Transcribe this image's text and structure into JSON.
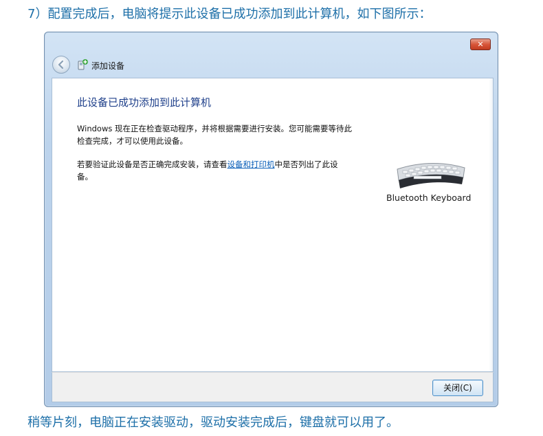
{
  "caption_top": "7）配置完成后，电脑将提示此设备已成功添加到此计算机，如下图所示：",
  "caption_bottom": "稍等片刻，电脑正在安装驱动，驱动安装完成后，键盘就可以用了。",
  "window": {
    "close_glyph": "✕",
    "title": "添加设备",
    "back_icon": "back-arrow-icon",
    "title_icon": "add-device-icon"
  },
  "content": {
    "heading": "此设备已成功添加到此计算机",
    "para1": "Windows 现在正在检查驱动程序，并将根据需要进行安装。您可能需要等待此检查完成，才可以使用此设备。",
    "para2_before": "若要验证此设备是否正确完成安装，请查看",
    "para2_link": "设备和打印机",
    "para2_after": "中是否列出了此设备。",
    "device_label": "Bluetooth Keyboard",
    "device_icon": "keyboard-icon"
  },
  "footer": {
    "close_button": "关闭(C)"
  },
  "colors": {
    "caption": "#1d6fa8",
    "heading": "#1e3f8a",
    "link": "#0b5fb9",
    "close_red": "#c23c20"
  }
}
